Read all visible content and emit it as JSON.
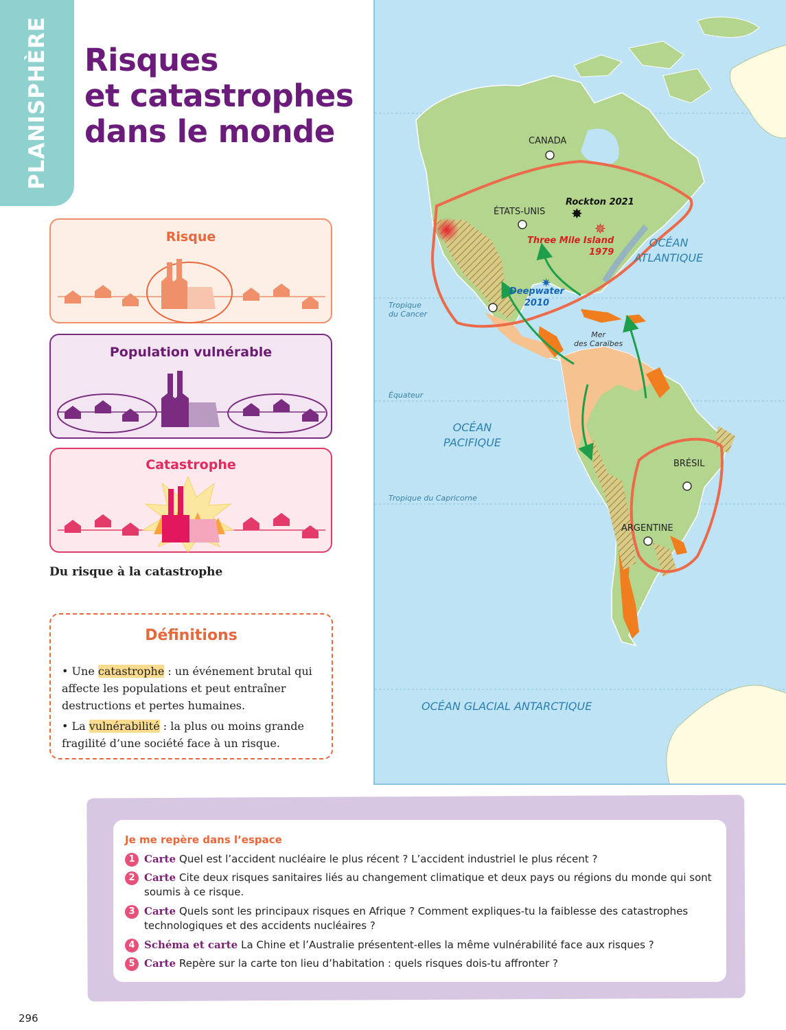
{
  "side_tab": {
    "label": "PLANISPHÈRE"
  },
  "title": {
    "lines": [
      "Risques",
      "et catastrophes",
      "dans le monde"
    ]
  },
  "diagram": {
    "panels": [
      {
        "title": "Risque"
      },
      {
        "title": "Population vulnérable"
      },
      {
        "title": "Catastrophe"
      }
    ],
    "caption": "Du risque à la catastrophe"
  },
  "definitions": {
    "title": "Définitions",
    "items": [
      {
        "prefix": "• Une ",
        "term": "catastrophe",
        "text": " : un événement brutal qui affecte les populations et peut entraîner destructions et pertes humaines."
      },
      {
        "prefix": "• La ",
        "term": "vulnérabilité",
        "text": " : la plus ou moins grande fragilité d’une société face à un risque."
      }
    ]
  },
  "map": {
    "countries": {
      "canada": "CANADA",
      "usa": "ÉTATS-UNIS",
      "bresil": "BRÉSIL",
      "argentine": "ARGENTINE"
    },
    "oceans": {
      "atlantique": [
        "OCÉAN",
        "ATLANTIQUE"
      ],
      "pacifique": [
        "OCÉAN",
        "PACIFIQUE"
      ],
      "antarctique": "OCÉAN GLACIAL ANTARCTIQUE"
    },
    "lines": {
      "cancer": [
        "Tropique",
        "du Cancer"
      ],
      "equateur": "Équateur",
      "capricorne": "Tropique du Capricorne",
      "caraibes": [
        "Mer",
        "des Caraïbes"
      ]
    },
    "events": {
      "rockton": "Rockton 2021",
      "three_mile": [
        "Three Mile Island",
        "1979"
      ],
      "deepwater": [
        "Deepwater",
        "2010"
      ]
    },
    "colors": {
      "ocean": "#bde3f5",
      "land": "#b3d58e",
      "risk_zone": "#f6c28f",
      "high_risk": "#f07e1e",
      "circle": "#ec6a4a",
      "arrow": "#1e9e4a"
    }
  },
  "questions": {
    "heading": "Je me repère dans l’espace",
    "items": [
      {
        "num": "1",
        "kind": "Carte",
        "text": "Quel est l’accident nucléaire le plus récent ? L’accident industriel le plus récent ?"
      },
      {
        "num": "2",
        "kind": "Carte",
        "text": "Cite deux risques sanitaires liés au changement climatique et deux pays ou régions du monde qui sont soumis à ce risque."
      },
      {
        "num": "3",
        "kind": "Carte",
        "text": "Quels sont les principaux risques en Afrique ? Comment expliques-tu la faiblesse des catastrophes technologiques et des accidents nucléaires ?"
      },
      {
        "num": "4",
        "kind": "Schéma et carte",
        "text": "La Chine et l’Australie présentent-elles la même vulnérabilité face aux risques ?"
      },
      {
        "num": "5",
        "kind": "Carte",
        "text": "Repère sur la carte ton lieu d’habitation : quels risques dois-tu affronter ?"
      }
    ]
  },
  "page_number": "296"
}
